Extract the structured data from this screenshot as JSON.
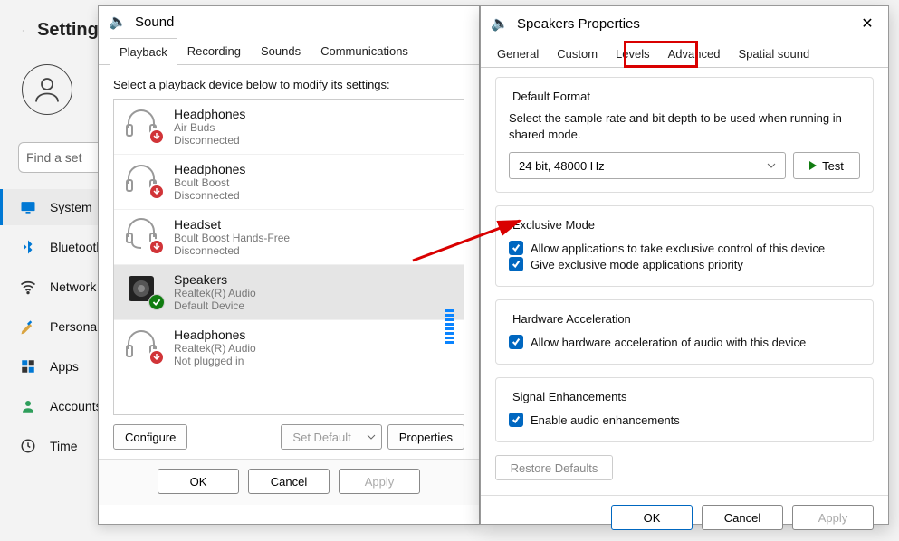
{
  "settings": {
    "title": "Settings",
    "search_placeholder": "Find a set",
    "nav": [
      {
        "label": "System",
        "sel": true,
        "icon": "monitor"
      },
      {
        "label": "Bluetooth",
        "icon": "bt"
      },
      {
        "label": "Network",
        "icon": "wifi"
      },
      {
        "label": "Personalization",
        "icon": "brush"
      },
      {
        "label": "Apps",
        "icon": "apps"
      },
      {
        "label": "Accounts",
        "icon": "person"
      },
      {
        "label": "Time",
        "icon": "clock"
      }
    ]
  },
  "sound": {
    "title": "Sound",
    "tabs": [
      "Playback",
      "Recording",
      "Sounds",
      "Communications"
    ],
    "active_tab": 0,
    "instruction": "Select a playback device below to modify its settings:",
    "devices": [
      {
        "name": "Headphones",
        "sub": "Air Buds",
        "stat": "Disconnected",
        "icon": "hp",
        "badge": "down"
      },
      {
        "name": "Headphones",
        "sub": "Boult Boost",
        "stat": "Disconnected",
        "icon": "hp",
        "badge": "down"
      },
      {
        "name": "Headset",
        "sub": "Boult Boost Hands-Free",
        "stat": "Disconnected",
        "icon": "hs",
        "badge": "down"
      },
      {
        "name": "Speakers",
        "sub": "Realtek(R) Audio",
        "stat": "Default Device",
        "icon": "spk",
        "badge": "ok",
        "selected": true
      },
      {
        "name": "Headphones",
        "sub": "Realtek(R) Audio",
        "stat": "Not plugged in",
        "icon": "hp",
        "badge": "down"
      }
    ],
    "btn_configure": "Configure",
    "btn_setdefault": "Set Default",
    "btn_properties": "Properties",
    "btn_ok": "OK",
    "btn_cancel": "Cancel",
    "btn_apply": "Apply"
  },
  "props": {
    "title": "Speakers Properties",
    "tabs": [
      "General",
      "Custom",
      "Levels",
      "Advanced",
      "Spatial sound"
    ],
    "highlighted_tab": 3,
    "groups": {
      "default_format": {
        "title": "Default Format",
        "desc": "Select the sample rate and bit depth to be used when running in shared mode.",
        "value": "24 bit, 48000 Hz",
        "test": "Test"
      },
      "exclusive": {
        "title": "Exclusive Mode",
        "opt1": "Allow applications to take exclusive control of this device",
        "opt2": "Give exclusive mode applications priority"
      },
      "hw": {
        "title": "Hardware Acceleration",
        "opt1": "Allow hardware acceleration of audio with this device"
      },
      "sig": {
        "title": "Signal Enhancements",
        "opt1": "Enable audio enhancements"
      }
    },
    "restore": "Restore Defaults",
    "btn_ok": "OK",
    "btn_cancel": "Cancel",
    "btn_apply": "Apply"
  }
}
